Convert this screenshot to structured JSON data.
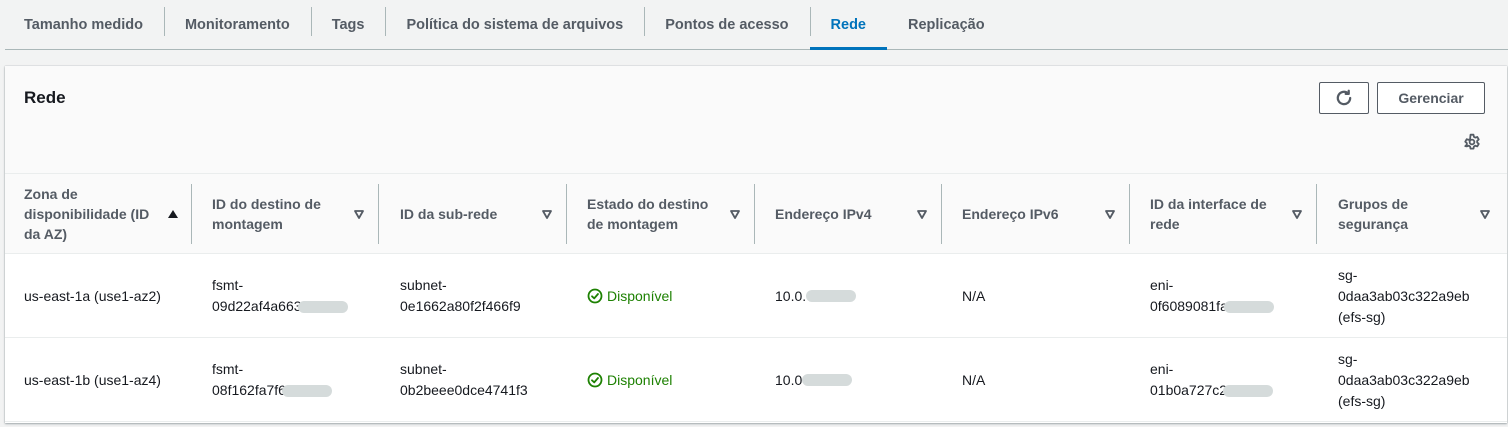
{
  "tabs": [
    {
      "label": "Tamanho medido",
      "active": false
    },
    {
      "label": "Monitoramento",
      "active": false
    },
    {
      "label": "Tags",
      "active": false
    },
    {
      "label": "Política do sistema de arquivos",
      "active": false
    },
    {
      "label": "Pontos de acesso",
      "active": false
    },
    {
      "label": "Rede",
      "active": true
    },
    {
      "label": "Replicação",
      "active": false
    }
  ],
  "panel": {
    "title": "Rede",
    "manage_label": "Gerenciar",
    "refresh_icon": "refresh-icon",
    "settings_icon": "gear-icon"
  },
  "columns": [
    {
      "lines": [
        "Zona de",
        "disponibilidade (ID",
        "da AZ)"
      ],
      "sort": "ascending"
    },
    {
      "lines": [
        "ID do destino de",
        "montagem"
      ],
      "sort": "none"
    },
    {
      "lines": [
        "ID da sub-rede"
      ],
      "sort": "none"
    },
    {
      "lines": [
        "Estado do destino",
        "de montagem"
      ],
      "sort": "none"
    },
    {
      "lines": [
        "Endereço IPv4"
      ],
      "sort": "none"
    },
    {
      "lines": [
        "Endereço IPv6"
      ],
      "sort": "none"
    },
    {
      "lines": [
        "ID da interface de",
        "rede"
      ],
      "sort": "none"
    },
    {
      "lines": [
        "Grupos de",
        "segurança"
      ],
      "sort": "none"
    }
  ],
  "rows": [
    {
      "az": "us-east-1a (use1-az2)",
      "mount_target": [
        "fsmt-",
        "09d22af4a663"
      ],
      "subnet": [
        "subnet-",
        "0e1662a80f2f466f9"
      ],
      "state": "Disponível",
      "ipv4": "10.0.",
      "ipv6": "N/A",
      "eni": [
        "eni-",
        "0f6089081fa"
      ],
      "sg": [
        "sg-",
        "0daa3ab03c322a9eb",
        "(efs-sg)"
      ]
    },
    {
      "az": "us-east-1b (use1-az4)",
      "mount_target": [
        "fsmt-",
        "08f162fa7f6"
      ],
      "subnet": [
        "subnet-",
        "0b2beee0dce4741f3"
      ],
      "state": "Disponível",
      "ipv4": "10.0",
      "ipv6": "N/A",
      "eni": [
        "eni-",
        "01b0a727c2"
      ],
      "sg": [
        "sg-",
        "0daa3ab03c322a9eb",
        "(efs-sg)"
      ]
    }
  ],
  "colors": {
    "accent": "#0073bb",
    "success": "#1d8102",
    "text_secondary": "#545b64"
  }
}
